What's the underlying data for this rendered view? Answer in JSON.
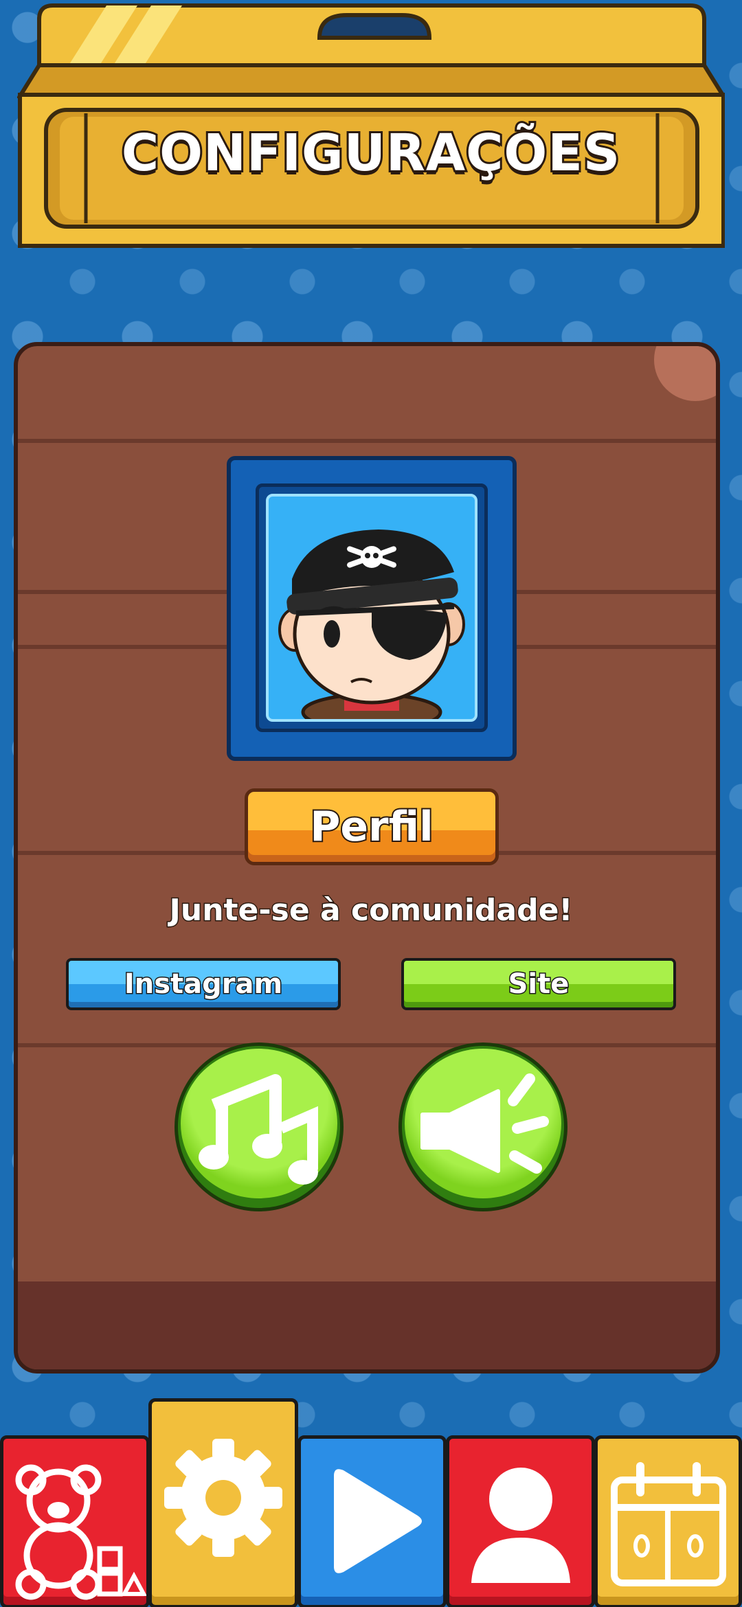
{
  "header": {
    "title": "CONFIGURAÇÕES"
  },
  "profile": {
    "button_label": "Perfil",
    "avatar": "pirate-avatar"
  },
  "community": {
    "text": "Junte-se à comunidade!",
    "instagram_label": "Instagram",
    "site_label": "Site"
  },
  "toggles": {
    "music_icon": "music-note-icon",
    "sound_icon": "speaker-icon"
  },
  "nav": {
    "items": [
      {
        "icon": "teddy-bear-icon",
        "color": "#e8232f"
      },
      {
        "icon": "gear-icon",
        "color": "#f2bf3c",
        "active": true
      },
      {
        "icon": "play-icon",
        "color": "#2b8ee6"
      },
      {
        "icon": "person-icon",
        "color": "#e8232f"
      },
      {
        "icon": "calendar-icon",
        "color": "#f2bf3c"
      }
    ]
  },
  "colors": {
    "background": "#1b6db4",
    "panel": "#8a4f3c",
    "green_button": "#7fd31f",
    "orange_button": "#f08a1a"
  }
}
